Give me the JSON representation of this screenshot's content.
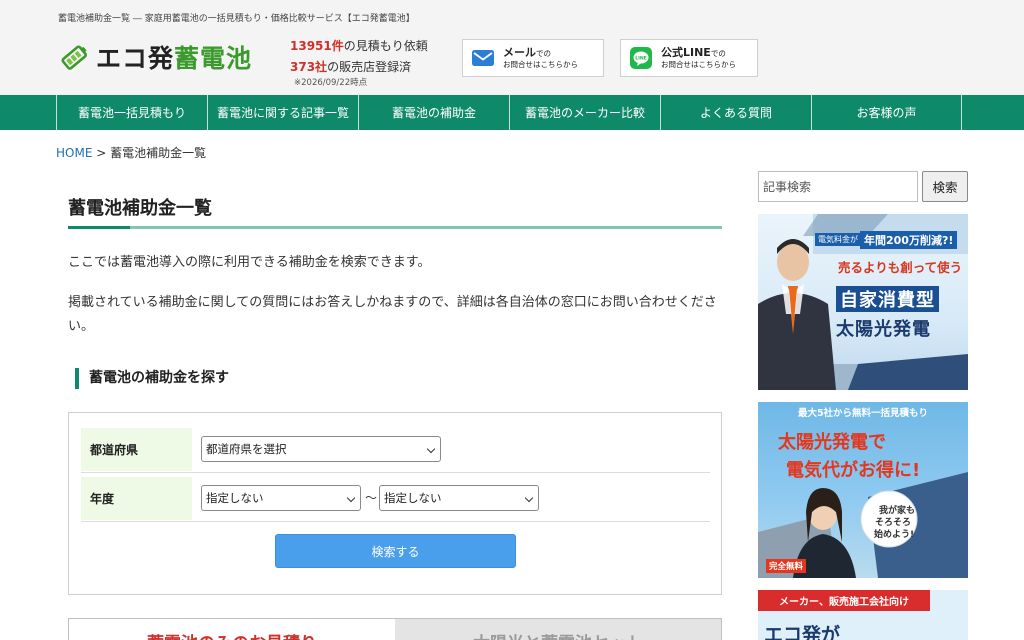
{
  "header": {
    "tagline": "蓄電池補助金一覧 ― 家庭用蓄電池の一括見積もり・価格比較サービス【エコ発蓄電池】",
    "logo": {
      "prefix": "エコ発",
      "accent": "蓄電池"
    },
    "stats": {
      "estimates_num": "13951件",
      "estimates_text": "の見積もり依頼",
      "dealers_num": "373社",
      "dealers_text": "の販売店登録済",
      "note": "※2026/09/22時点"
    },
    "mail_button": {
      "main": "メール",
      "main_suffix": "での",
      "sub": "お問合せはこちらから",
      "icon": "mail-icon"
    },
    "line_button": {
      "main": "公式LINE",
      "main_suffix": "での",
      "sub": "お問合せはこちらから",
      "icon": "line-icon"
    }
  },
  "nav": {
    "items": [
      {
        "label": "蓄電池一括見積もり"
      },
      {
        "label": "蓄電池に関する記事一覧"
      },
      {
        "label": "蓄電池の補助金"
      },
      {
        "label": "蓄電池のメーカー比較"
      },
      {
        "label": "よくある質問"
      },
      {
        "label": "お客様の声"
      }
    ]
  },
  "breadcrumb": {
    "home": "HOME",
    "separator": ">",
    "current": "蓄電池補助金一覧"
  },
  "main": {
    "title": "蓄電池補助金一覧",
    "paragraph1": "ここでは蓄電池導入の際に利用できる補助金を検索できます。",
    "paragraph2": "掲載されている補助金に関しての質問にはお答えしかねますので、詳細は各自治体の窓口にお問い合わせください。",
    "search_heading": "蓄電池の補助金を探す",
    "form": {
      "prefecture_label": "都道府県",
      "prefecture_value": "都道府県を選択",
      "year_label": "年度",
      "year_from_value": "指定しない",
      "tilde": "〜",
      "year_to_value": "指定しない",
      "submit_label": "検索する"
    },
    "tabs": [
      {
        "label": "蓄電池のみのお見積り"
      },
      {
        "label": "太陽光と蓄電池セット"
      }
    ]
  },
  "sidebar": {
    "search_placeholder": "記事検索",
    "search_button": "検索",
    "banner1": {
      "badge": "電気料金が",
      "headline": "年間200万削減?!",
      "line1": "売るよりも創って使う",
      "line2": "自家消費型",
      "line3": "太陽光発電"
    },
    "banner2": {
      "top": "最大5社から無料一括見積もり",
      "line1": "太陽光発電で",
      "line2": "電気代がお得に!",
      "bubble1": "我が家も",
      "bubble2": "そろそろ",
      "bubble3": "始めよう!",
      "free": "完全無料"
    },
    "banner3": {
      "top": "メーカー、販売施工会社向け",
      "line1": "エコ発が"
    }
  },
  "colors": {
    "brand_green": "#0e8a6b",
    "logo_green": "#3a9a2b",
    "accent_red": "#d0302a",
    "button_blue": "#4a9fec",
    "link_blue": "#1f6fb5"
  }
}
